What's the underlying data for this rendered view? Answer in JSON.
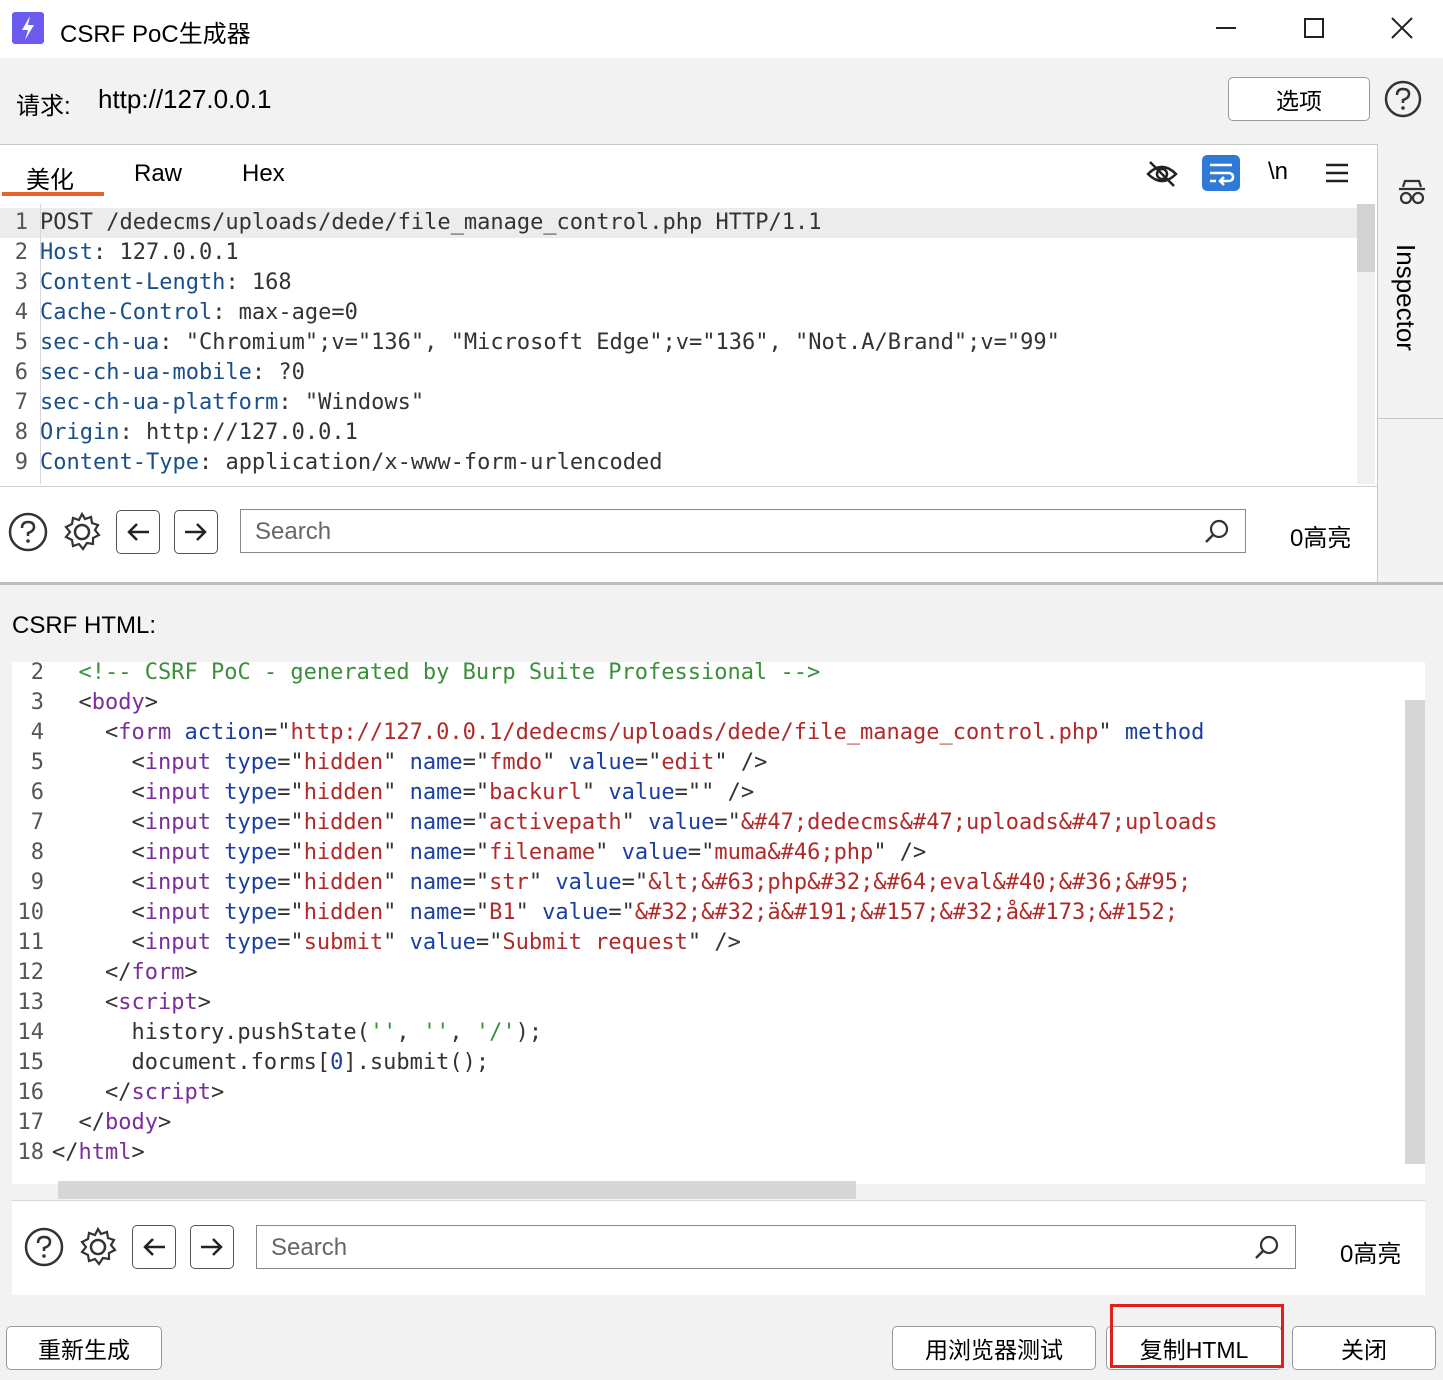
{
  "window": {
    "title": "CSRF PoC生成器",
    "controls": [
      "minimize-icon",
      "maximize-icon",
      "close-icon"
    ],
    "accent_color": "#6b5bf0"
  },
  "request": {
    "label": "请求:",
    "url": "http://127.0.0.1",
    "options_label": "选项"
  },
  "request_editor": {
    "tabs": [
      "美化",
      "Raw",
      "Hex"
    ],
    "active_tab": "美化",
    "toolbar_icons": [
      "hide-icon",
      "wrap-icon",
      "newline-icon",
      "menu-icon"
    ],
    "newline_label": "\\n",
    "lines": [
      {
        "n": "1",
        "key": "POST /dedecms/uploads/dede/file_manage_control.php HTTP/1.1",
        "val": ""
      },
      {
        "n": "2",
        "key": "Host",
        "val": ": 127.0.0.1"
      },
      {
        "n": "3",
        "key": "Content-Length",
        "val": ": 168"
      },
      {
        "n": "4",
        "key": "Cache-Control",
        "val": ": max-age=0"
      },
      {
        "n": "5",
        "key": "sec-ch-ua",
        "val": ": \"Chromium\";v=\"136\", \"Microsoft Edge\";v=\"136\", \"Not.A/Brand\";v=\"99\""
      },
      {
        "n": "6",
        "key": "sec-ch-ua-mobile",
        "val": ": ?0"
      },
      {
        "n": "7",
        "key": "sec-ch-ua-platform",
        "val": ": \"Windows\""
      },
      {
        "n": "8",
        "key": "Origin",
        "val": ": http://127.0.0.1"
      },
      {
        "n": "9",
        "key": "Content-Type",
        "val": ": application/x-www-form-urlencoded"
      }
    ],
    "search_placeholder": "Search",
    "highlight_count": "0高亮"
  },
  "inspector": {
    "label": "Inspector"
  },
  "csrf": {
    "label": "CSRF HTML:",
    "search_placeholder": "Search",
    "highlight_count": "0高亮"
  },
  "buttons": {
    "regenerate": "重新生成",
    "test_in_browser": "用浏览器测试",
    "copy_html": "复制HTML",
    "close": "关闭"
  }
}
